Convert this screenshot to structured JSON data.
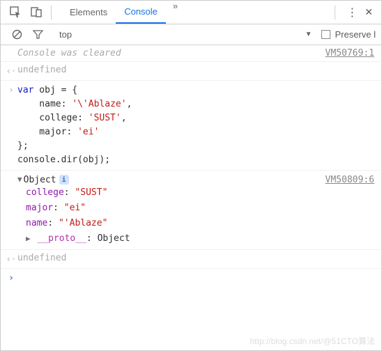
{
  "toolbar": {
    "tabs": {
      "elements": "Elements",
      "console": "Console"
    },
    "more_glyph": "»",
    "menu_glyph": "⋮",
    "close_glyph": "✕"
  },
  "subbar": {
    "context": "top",
    "dropdown_glyph": "▼",
    "preserve_label": "Preserve l"
  },
  "log": {
    "cleared_msg": "Console was cleared",
    "cleared_src": "VM50769:1",
    "undef": "undefined",
    "code": {
      "l1a": "var",
      "l1b": " obj = {",
      "l2a": "    name: ",
      "l2b": "'\\'Ablaze'",
      "l2c": ",",
      "l3a": "    college: ",
      "l3b": "'SUST'",
      "l3c": ",",
      "l4a": "    major: ",
      "l4b": "'ei'",
      "l5": "};",
      "l6": "console.dir(obj);"
    },
    "obj": {
      "title": "Object",
      "src": "VM50809:6",
      "props": {
        "college_k": "college",
        "college_v": "\"SUST\"",
        "major_k": "major",
        "major_v": "\"ei\"",
        "name_k": "name",
        "name_v": "\"'Ablaze\"",
        "proto_k": "__proto__",
        "proto_v": "Object"
      }
    }
  },
  "watermark": "http://blog.csdn.net/@51CTO算法"
}
